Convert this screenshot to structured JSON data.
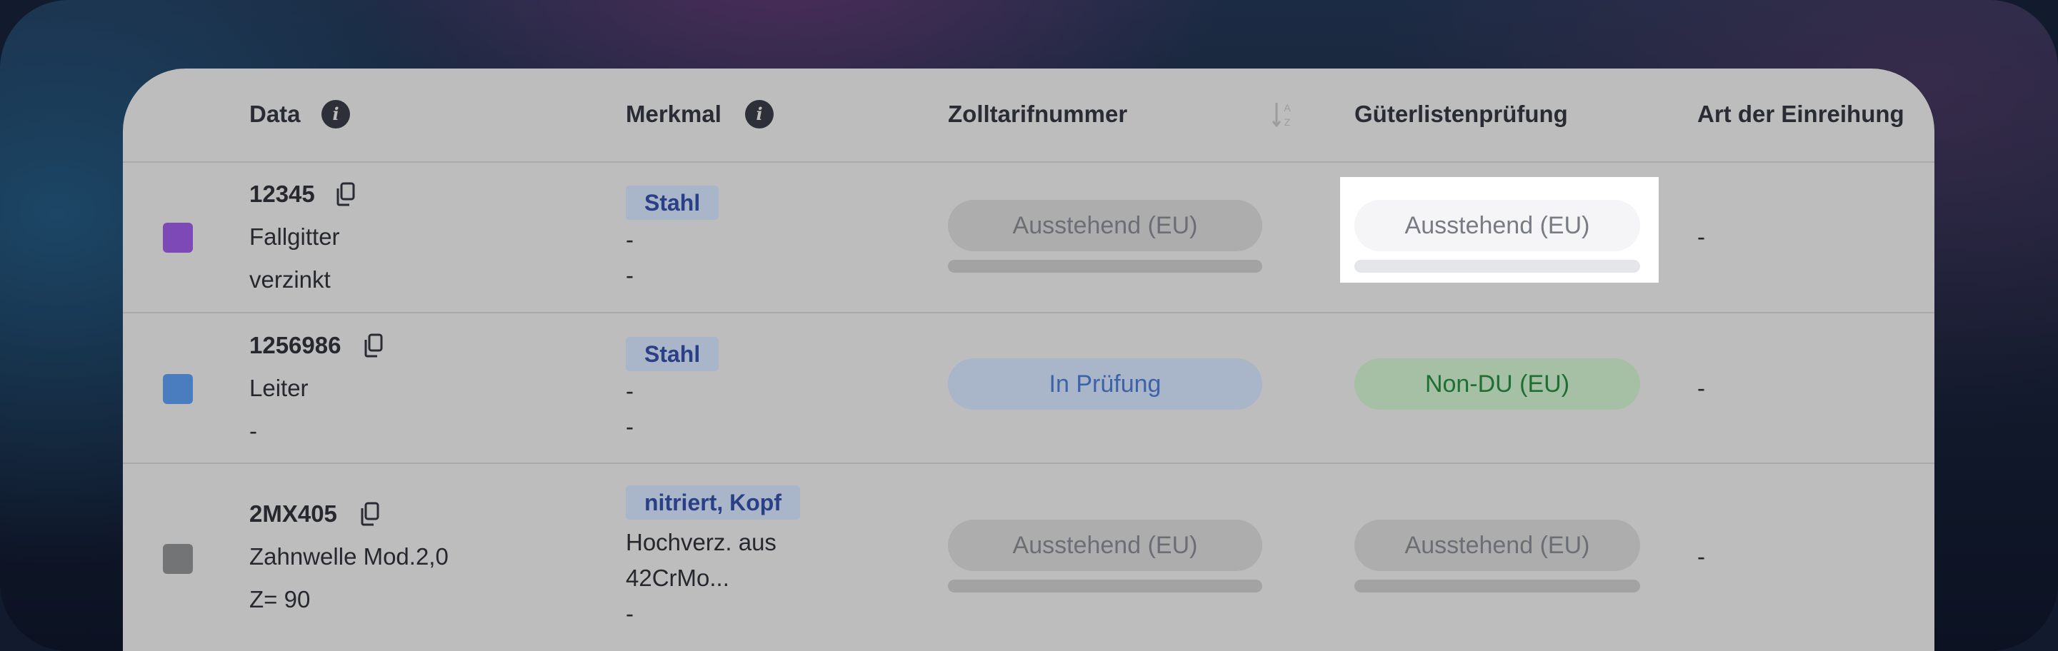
{
  "colors": {
    "swatch_purple": "#7d49b6",
    "swatch_blue": "#4a7dbf",
    "swatch_gray": "#737476",
    "accent_blue": "#3c63a8",
    "accent_green": "#1f6e33"
  },
  "table": {
    "columns": [
      {
        "label": "Data",
        "info_icon": true
      },
      {
        "label": "Merkmal",
        "info_icon": true
      },
      {
        "label": "Zolltarifnummer",
        "sort_icon": "sort-az-icon"
      },
      {
        "label": "Güterlistenprüfung"
      },
      {
        "label": "Art der Einreihung"
      }
    ],
    "info_glyph": "i",
    "rows": [
      {
        "id": "12345",
        "line1": "Fallgitter",
        "line2": "verzinkt",
        "tag": "Stahl",
        "merkmal_lines": [
          "-",
          "-"
        ],
        "zoll_status": "Ausstehend (EU)",
        "gueter_status": "Ausstehend (EU)",
        "art": "-"
      },
      {
        "id": "1256986",
        "line1": "Leiter",
        "line2": "-",
        "tag": "Stahl",
        "merkmal_lines": [
          "-",
          "-"
        ],
        "zoll_status": "In Prüfung",
        "gueter_status": "Non-DU (EU)",
        "art": "-"
      },
      {
        "id": "2MX405",
        "line1": "Zahnwelle Mod.2,0",
        "line2": "Z= 90",
        "tag": "nitriert, Kopf",
        "merkmal_lines": [
          "Hochverz. aus",
          "42CrMo...",
          "-"
        ],
        "zoll_status": "Ausstehend (EU)",
        "gueter_status": "Ausstehend (EU)",
        "art": "-"
      }
    ]
  }
}
